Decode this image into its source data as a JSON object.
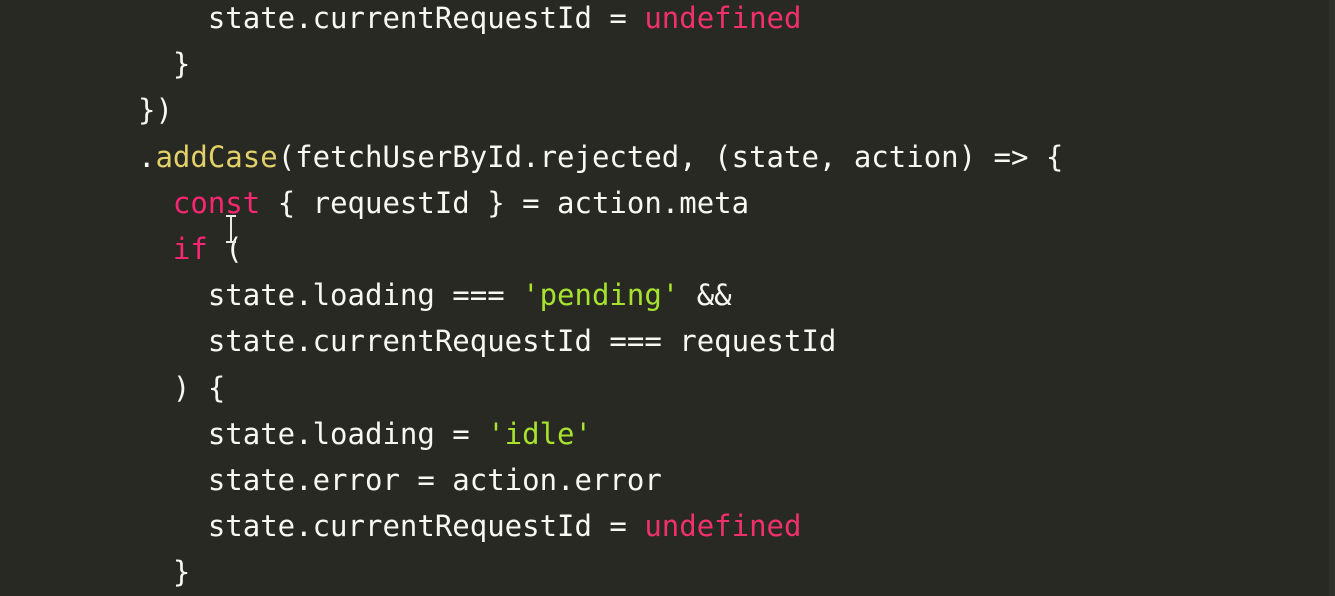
{
  "colors": {
    "background": "#282923",
    "plain": "#f8f8f2",
    "keyword": "#f92672",
    "function": "#e2d068",
    "string": "#a6e22e"
  },
  "lines": [
    {
      "indent": "      ",
      "tokens": [
        {
          "t": "state.currentRequestId = ",
          "c": "plain"
        },
        {
          "t": "undefined",
          "c": "undef"
        }
      ]
    },
    {
      "indent": "    ",
      "tokens": [
        {
          "t": "}",
          "c": "plain"
        }
      ]
    },
    {
      "indent": "  ",
      "tokens": [
        {
          "t": "})",
          "c": "plain"
        }
      ]
    },
    {
      "indent": "  ",
      "tokens": [
        {
          "t": ".",
          "c": "plain"
        },
        {
          "t": "addCase",
          "c": "func"
        },
        {
          "t": "(fetchUserById.rejected, (state, action) => {",
          "c": "plain"
        }
      ]
    },
    {
      "indent": "    ",
      "tokens": [
        {
          "t": "const",
          "c": "kw"
        },
        {
          "t": " { requestId } = action.meta",
          "c": "plain"
        }
      ]
    },
    {
      "indent": "    ",
      "tokens": [
        {
          "t": "if",
          "c": "kw"
        },
        {
          "t": " (",
          "c": "plain"
        }
      ]
    },
    {
      "indent": "      ",
      "tokens": [
        {
          "t": "state.loading === ",
          "c": "plain"
        },
        {
          "t": "'pending'",
          "c": "str"
        },
        {
          "t": " &&",
          "c": "plain"
        }
      ]
    },
    {
      "indent": "      ",
      "tokens": [
        {
          "t": "state.currentRequestId === requestId",
          "c": "plain"
        }
      ]
    },
    {
      "indent": "    ",
      "tokens": [
        {
          "t": ") {",
          "c": "plain"
        }
      ]
    },
    {
      "indent": "      ",
      "tokens": [
        {
          "t": "state.loading = ",
          "c": "plain"
        },
        {
          "t": "'idle'",
          "c": "str"
        }
      ]
    },
    {
      "indent": "      ",
      "tokens": [
        {
          "t": "state.error = action.error",
          "c": "plain"
        }
      ]
    },
    {
      "indent": "      ",
      "tokens": [
        {
          "t": "state.currentRequestId = ",
          "c": "plain"
        },
        {
          "t": "undefined",
          "c": "undef"
        }
      ]
    },
    {
      "indent": "    ",
      "tokens": [
        {
          "t": "}",
          "c": "plain"
        }
      ]
    }
  ],
  "cursor_icon": "text-cursor-icon"
}
